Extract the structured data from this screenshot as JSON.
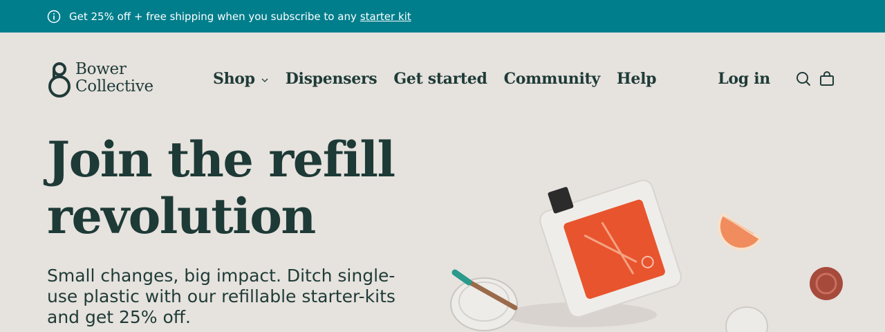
{
  "announcement": {
    "text": "Get 25% off + free shipping when you subscribe to any",
    "link_text": "starter kit",
    "icon": "info-icon"
  },
  "brand": {
    "name_line1": "Bower",
    "name_line2": "Collective"
  },
  "nav": {
    "items": [
      {
        "label": "Shop",
        "has_dropdown": true
      },
      {
        "label": "Dispensers"
      },
      {
        "label": "Get started"
      },
      {
        "label": "Community"
      },
      {
        "label": "Help"
      }
    ]
  },
  "header_actions": {
    "login_label": "Log in",
    "search_icon": "search-icon",
    "cart_icon": "cart-icon"
  },
  "hero": {
    "title_line1": "Join the refill",
    "title_line2": "revolution",
    "subtitle": "Small changes, big impact. Ditch single-use plastic with our refillable starter-kits and get 25% off."
  },
  "colors": {
    "announcement_bg": "#007e8c",
    "page_bg": "#e6e2de",
    "text_dark": "#1f3b37",
    "pouch_orange": "#e8542d"
  }
}
